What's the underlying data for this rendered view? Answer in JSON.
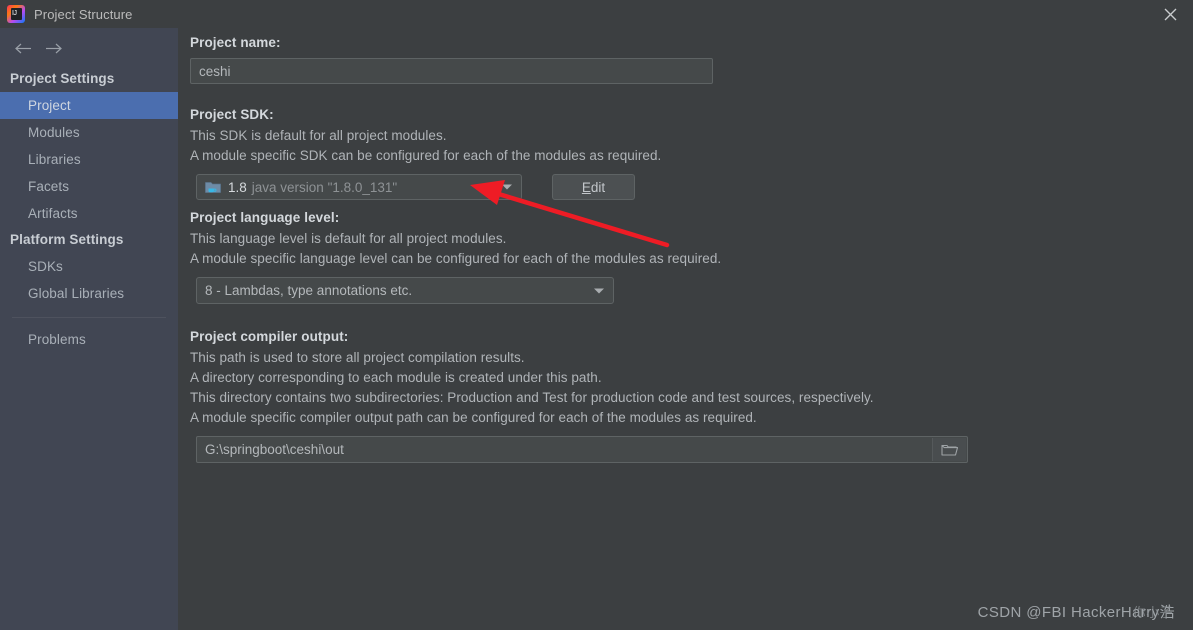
{
  "window": {
    "title": "Project Structure",
    "app_icon": "intellij-idea-icon",
    "close_label": "✕"
  },
  "sidebar": {
    "back_icon": "arrow-left-icon",
    "forward_icon": "arrow-right-icon",
    "groups": [
      {
        "label": "Project Settings",
        "items": [
          {
            "label": "Project",
            "selected": true
          },
          {
            "label": "Modules",
            "selected": false
          },
          {
            "label": "Libraries",
            "selected": false
          },
          {
            "label": "Facets",
            "selected": false
          },
          {
            "label": "Artifacts",
            "selected": false
          }
        ]
      },
      {
        "label": "Platform Settings",
        "items": [
          {
            "label": "SDKs",
            "selected": false
          },
          {
            "label": "Global Libraries",
            "selected": false
          }
        ]
      }
    ],
    "problems_label": "Problems"
  },
  "main": {
    "project_name": {
      "label": "Project name:",
      "value": "ceshi"
    },
    "project_sdk": {
      "label": "Project SDK:",
      "desc_line1": "This SDK is default for all project modules.",
      "desc_line2": "A module specific SDK can be configured for each of the modules as required.",
      "selected_version": "1.8",
      "selected_description": "java version \"1.8.0_131\"",
      "dropdown_icon": "chevron-down-icon",
      "sdk_icon": "java-sdk-folder-icon",
      "edit_button": {
        "mnemonic": "E",
        "rest": "dit"
      }
    },
    "language_level": {
      "label": "Project language level:",
      "desc_line1": "This language level is default for all project modules.",
      "desc_line2": "A module specific language level can be configured for each of the modules as required.",
      "selected": "8 - Lambdas, type annotations etc.",
      "dropdown_icon": "chevron-down-icon"
    },
    "compiler_output": {
      "label": "Project compiler output:",
      "desc_line1": "This path is used to store all project compilation results.",
      "desc_line2": "A directory corresponding to each module is created under this path.",
      "desc_line3": "This directory contains two subdirectories: Production and Test for production code and test sources, respectively.",
      "desc_line4": "A module specific compiler output path can be configured for each of the modules as required.",
      "path_value": "G:\\springboot\\ceshi\\out",
      "browse_icon": "folder-browse-icon"
    }
  },
  "annotation": {
    "arrow_color": "#ee1c25",
    "arrow_label": "red-pointer-arrow"
  },
  "watermark": {
    "text": "CSDN @FBI HackerHarry浩",
    "overlay_text": "你小子"
  },
  "colors": {
    "sidebar_bg": "#414653",
    "panel_bg": "#3c3f41",
    "selection": "#4b6eaf",
    "field_bg": "#45494a",
    "border": "#5e6364",
    "text_primary": "#d4d8dc",
    "text_secondary": "#b0b4b8"
  }
}
